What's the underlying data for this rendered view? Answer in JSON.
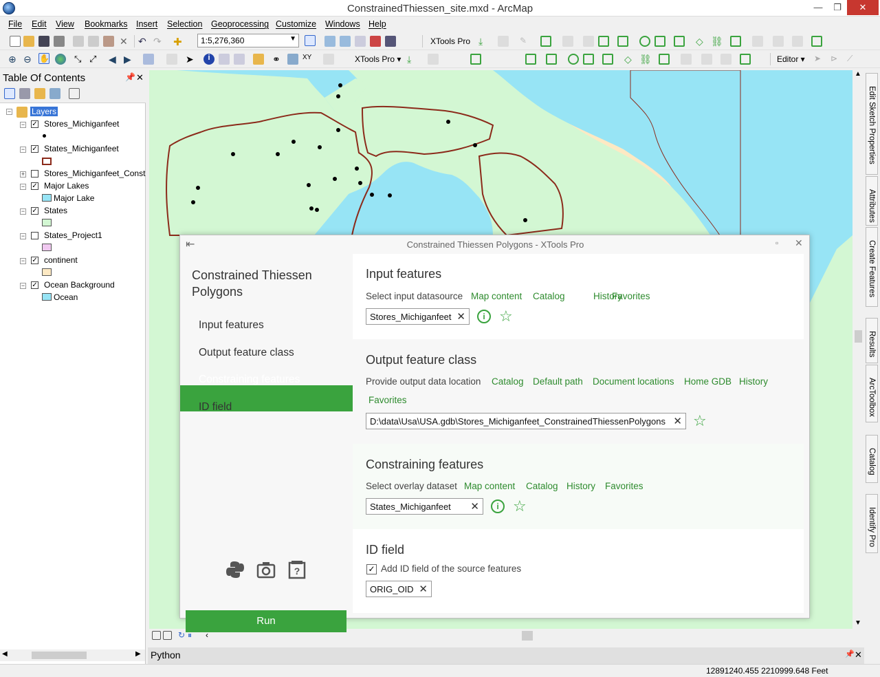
{
  "window": {
    "title": "ConstrainedThiessen_site.mxd - ArcMap"
  },
  "menu": [
    "File",
    "Edit",
    "View",
    "Bookmarks",
    "Insert",
    "Selection",
    "Geoprocessing",
    "Customize",
    "Windows",
    "Help"
  ],
  "toolbar": {
    "scale": "1:5,276,360",
    "xtools_label": "XTools Pro",
    "xtools_menu": "XTools Pro ▾",
    "editor_menu": "Editor ▾"
  },
  "toc": {
    "title": "Table Of Contents",
    "root": "Layers",
    "layers": [
      {
        "name": "Stores_Michiganfeet",
        "checked": true,
        "sublabel": ""
      },
      {
        "name": "States_Michiganfeet",
        "checked": true,
        "sublabel": ""
      },
      {
        "name": "Stores_Michiganfeet_Const",
        "checked": false,
        "sublabel": ""
      },
      {
        "name": "Major Lakes",
        "checked": true,
        "sublabel": "Major Lake"
      },
      {
        "name": "States",
        "checked": true,
        "sublabel": ""
      },
      {
        "name": "States_Project1",
        "checked": false,
        "sublabel": ""
      },
      {
        "name": "continent",
        "checked": true,
        "sublabel": ""
      },
      {
        "name": "Ocean Background",
        "checked": true,
        "sublabel": "Ocean"
      }
    ]
  },
  "right_tabs": [
    "Edit Sketch Properties",
    "Attributes",
    "Create Features",
    "Results",
    "ArcToolbox",
    "Catalog",
    "Identify Pro"
  ],
  "dialog": {
    "title": "Constrained Thiessen Polygons - XTools Pro",
    "heading": "Constrained Thiessen Polygons",
    "nav": [
      "Input features",
      "Output feature class",
      "Constraining features",
      "ID field"
    ],
    "run_label": "Run",
    "sections": {
      "input": {
        "title": "Input features",
        "label": "Select input datasource",
        "links": [
          "Map content",
          "Catalog",
          "History",
          "Favorites"
        ],
        "value": "Stores_Michiganfeet"
      },
      "output": {
        "title": "Output feature class",
        "label": "Provide output data location",
        "links": [
          "Catalog",
          "Default path",
          "Document locations",
          "Home GDB",
          "History",
          "Favorites"
        ],
        "value": "D:\\data\\Usa\\USA.gdb\\Stores_Michiganfeet_ConstrainedThiessenPolygons"
      },
      "constraining": {
        "title": "Constraining features",
        "label": "Select overlay dataset",
        "links": [
          "Map content",
          "Catalog",
          "History",
          "Favorites"
        ],
        "value": "States_Michiganfeet"
      },
      "id": {
        "title": "ID field",
        "checkbox_label": "Add ID field of the source features",
        "checked": true,
        "value": "ORIG_OID"
      }
    }
  },
  "python_label": "Python",
  "status": {
    "coords": "12891240.455  2210999.648 Feet"
  },
  "colors": {
    "accent": "#3aa33e",
    "water": "#97e4f5",
    "land": "#d3f7d3",
    "continent": "#fde9c3",
    "state_border": "#8b2a1a"
  }
}
